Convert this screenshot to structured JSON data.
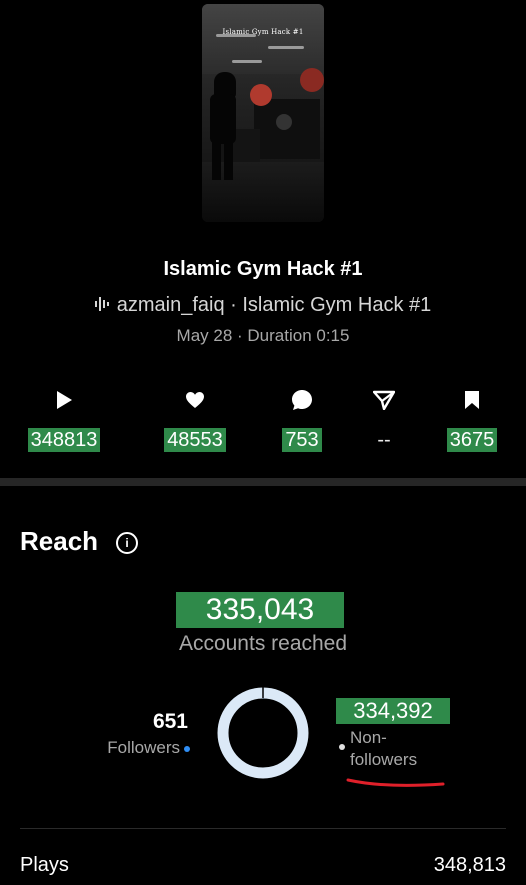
{
  "post": {
    "thumbnail_caption": "Islamic Gym Hack #1",
    "title": "Islamic Gym Hack #1",
    "audio_text": "azmain_faiq · Islamic Gym Hack #1",
    "meta_text": "May 28 · Duration 0:15"
  },
  "metrics": [
    {
      "icon": "play-icon",
      "value": "348813"
    },
    {
      "icon": "heart-icon",
      "value": "48553"
    },
    {
      "icon": "comment-icon",
      "value": "753"
    },
    {
      "icon": "share-icon",
      "value": "--"
    },
    {
      "icon": "bookmark-icon",
      "value": "3675"
    }
  ],
  "reach": {
    "title": "Reach",
    "accounts_reached_value": "335,043",
    "accounts_reached_label": "Accounts reached",
    "followers_value": "651",
    "followers_label": "Followers",
    "non_followers_value": "334,392",
    "non_followers_label_line1": "Non-",
    "non_followers_label_line2": "followers",
    "followers_fraction": 0.0019
  },
  "stats": {
    "plays_label": "Plays",
    "plays_value": "348,813"
  },
  "colors": {
    "highlight": "#2f8a4a",
    "followers_dot": "#2f8ef5",
    "donut_light": "#dbe9f7",
    "annotation_red": "#e0202a"
  }
}
